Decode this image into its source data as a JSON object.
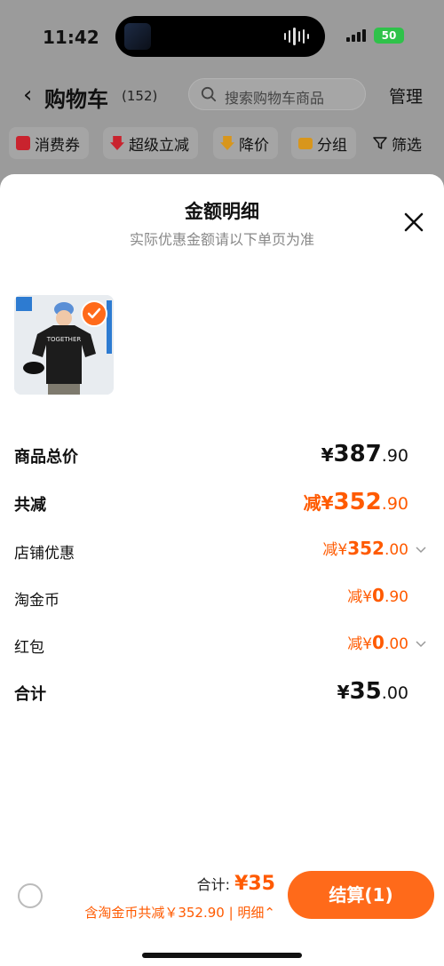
{
  "status_bar": {
    "time": "11:42",
    "battery": "50"
  },
  "nav": {
    "back_icon": "chevron-left-icon",
    "title": "购物车",
    "count": "(152)",
    "search_placeholder": "搜索购物车商品",
    "manage": "管理"
  },
  "filters": [
    {
      "icon": "coupon-icon",
      "label": "消费券"
    },
    {
      "icon": "down-arrow-icon",
      "label": "超级立减"
    },
    {
      "icon": "price-down-icon",
      "label": "降价"
    },
    {
      "icon": "folder-icon",
      "label": "分组"
    },
    {
      "icon": "filter-icon",
      "label": "筛选"
    }
  ],
  "sheet": {
    "title": "金额明细",
    "subtitle": "实际优惠金额请以下单页为准",
    "product_image_text": "TOGETHER",
    "rows": [
      {
        "label": "商品总价",
        "prefix": "¥",
        "int": "387",
        "dec": ".90"
      },
      {
        "label": "共减",
        "prefix": "减¥",
        "int": "352",
        "dec": ".90"
      },
      {
        "label": "店铺优惠",
        "prefix": "减¥",
        "int": "352",
        "dec": ".00"
      },
      {
        "label": "淘金币",
        "prefix": "减¥",
        "int": "0",
        "dec": ".90"
      },
      {
        "label": "红包",
        "prefix": "减¥",
        "int": "0",
        "dec": ".00"
      },
      {
        "label": "合计",
        "prefix": "¥",
        "int": "35",
        "dec": ".00"
      }
    ]
  },
  "footer": {
    "total_label": "合计:",
    "total_value": "¥35",
    "note": "含淘金币共减￥352.90 | 明细⌃",
    "pay_button": "结算(1)"
  },
  "colors": {
    "accent": "#ff5a00",
    "button": "#ff6a1a"
  }
}
